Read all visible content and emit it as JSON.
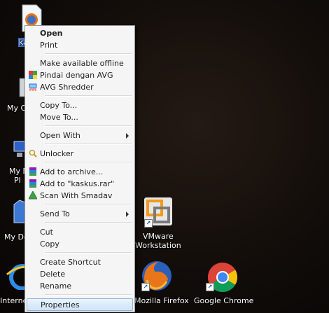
{
  "desktop": {
    "icons": [
      {
        "name": "kaskus-file",
        "label": "ka"
      },
      {
        "name": "my-computer",
        "label": "My C"
      },
      {
        "name": "my-network",
        "label1": "My N",
        "label2": "Pl"
      },
      {
        "name": "my-documents",
        "label": "My Do"
      },
      {
        "name": "internet-explorer",
        "label": "Interne"
      },
      {
        "name": "vmware",
        "label1": "VMware",
        "label2": "Workstation"
      },
      {
        "name": "firefox",
        "label": "Mozilla Firefox"
      },
      {
        "name": "chrome",
        "label": "Google Chrome"
      }
    ]
  },
  "context_menu": {
    "items": [
      {
        "label": "Open",
        "bold": true
      },
      {
        "label": "Print"
      },
      {
        "label": "Make available offline"
      },
      {
        "label": "Pindai dengan AVG",
        "icon": "avg-icon"
      },
      {
        "label": "AVG Shredder",
        "icon": "shredder-icon"
      },
      {
        "label": "Copy To..."
      },
      {
        "label": "Move To..."
      },
      {
        "label": "Open With",
        "submenu": true
      },
      {
        "label": "Unlocker",
        "icon": "unlocker-icon"
      },
      {
        "label": "Add to archive...",
        "icon": "winrar-icon"
      },
      {
        "label": "Add to \"kaskus.rar\"",
        "icon": "winrar-icon"
      },
      {
        "label": "Scan With Smadav",
        "icon": "smadav-icon"
      },
      {
        "label": "Send To",
        "submenu": true
      },
      {
        "label": "Cut"
      },
      {
        "label": "Copy"
      },
      {
        "label": "Create Shortcut"
      },
      {
        "label": "Delete"
      },
      {
        "label": "Rename"
      },
      {
        "label": "Properties",
        "highlighted": true
      }
    ]
  },
  "colors": {
    "menu_bg": "#f5f5f5",
    "highlight": "#cfe4fa",
    "desktop_bg": "#120d0a"
  }
}
